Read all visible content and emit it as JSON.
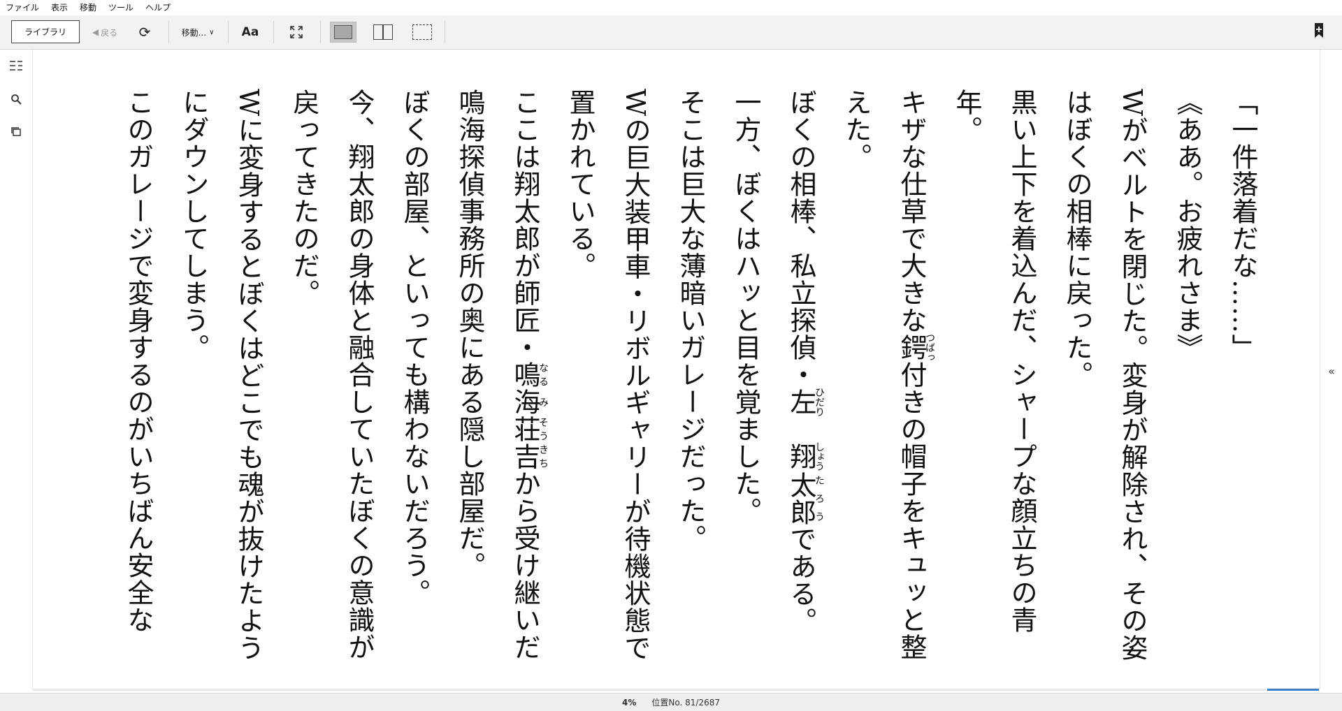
{
  "menubar": {
    "items": [
      "ファイル",
      "表示",
      "移動",
      "ツール",
      "ヘルプ"
    ]
  },
  "toolbar": {
    "library_label": "ライブラリ",
    "back_label": "戻る",
    "goto_label": "移動...",
    "font_label": "Aa"
  },
  "book": {
    "paragraphs": [
      "「一件落着だな……」",
      "《ああ。お疲れさま》",
      "Wがベルトを閉じた。変身が解除され、その姿はぼくの相棒に戻った。",
      "黒い上下を着込んだ、シャープな顔立ちの青年。",
      "キザな仕草で大きな鍔付きの帽子をキュッと整えた。",
      "ぼくの相棒、私立探偵・左翔太郎である。",
      "一方、ぼくはハッと目を覚ました。",
      "そこは巨大な薄暗いガレージだった。",
      "Wの巨大装甲車・リボルギャリーが待機状態で置かれている。",
      "ここは翔太郎が師匠・鳴海荘吉から受け継いだ鳴海探偵事務所の奥にある隠し部屋だ。",
      "ぼくの部屋、といっても構わないだろう。",
      "今、翔太郎の身体と融合していたぼくの意識が戻ってきたのだ。",
      "Wに変身するとぼくはどこでも魂が抜けたようにダウンしてしまう。",
      "このガレージで変身するのがいちばん安全な"
    ],
    "rubies": {
      "tsuba": {
        "base": "鍔",
        "reading": "つばっ"
      },
      "hidari": {
        "base": "左",
        "reading": "ひだり"
      },
      "shou": {
        "base": "翔",
        "reading": "しょう"
      },
      "tarou": {
        "base": "太郎",
        "reading": "たろう"
      },
      "naru": {
        "base": "鳴",
        "reading": "なる"
      },
      "mi": {
        "base": "海",
        "reading": "み"
      },
      "soukichi": {
        "base": "荘吉",
        "reading": "そうきち"
      }
    }
  },
  "status": {
    "percent": "4%",
    "location": "位置No. 81/2687",
    "progress": 0.04
  }
}
